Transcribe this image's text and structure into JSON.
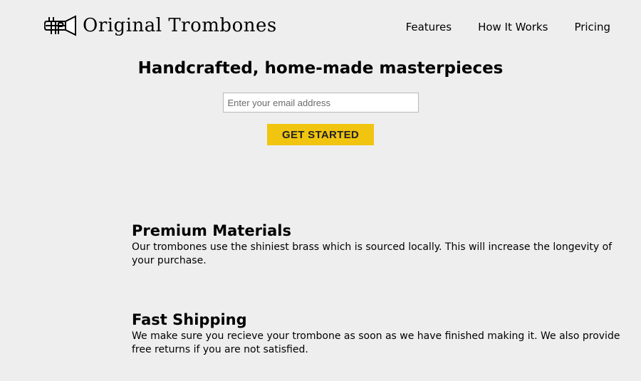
{
  "header": {
    "logo_icon": "trombone-logo-icon",
    "logo_text": "Original Trombones",
    "nav": [
      {
        "label": "Features"
      },
      {
        "label": "How It Works"
      },
      {
        "label": "Pricing"
      }
    ]
  },
  "hero": {
    "title": "Handcrafted, home-made masterpieces",
    "email_placeholder": "Enter your email address",
    "cta_label": "GET STARTED",
    "cta_color": "#f1c40f"
  },
  "features": [
    {
      "title": "Premium Materials",
      "description": "Our trombones use the shiniest brass which is sourced locally. This will increase the longevity of your purchase."
    },
    {
      "title": "Fast Shipping",
      "description": "We make sure you recieve your trombone as soon as we have finished making it. We also provide free returns if you are not satisfied."
    }
  ],
  "colors": {
    "background": "#eeeeee",
    "accent": "#f1c40f"
  }
}
